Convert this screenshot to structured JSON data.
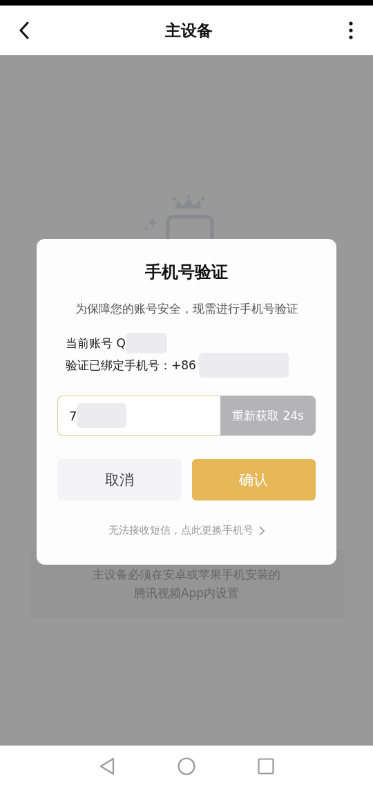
{
  "header": {
    "title": "主设备"
  },
  "background": {
    "notice": [
      "主设备必须在安卓或苹果手机安装的",
      "腾讯视频App内设置"
    ]
  },
  "dialog": {
    "title": "手机号验证",
    "message": "为保障您的账号安全，现需进行手机号验证",
    "account_label": "当前账号 Q",
    "bound_phone_label": "验证已绑定手机号：+86",
    "code_field": {
      "value": "7"
    },
    "resend_button": {
      "label": "重新获取 24s",
      "disabled": true
    },
    "buttons": [
      {
        "label": "取消",
        "kind": "secondary"
      },
      {
        "label": "确认",
        "kind": "primary"
      }
    ],
    "change_phone_link": "无法接收短信，点此更换手机号"
  }
}
